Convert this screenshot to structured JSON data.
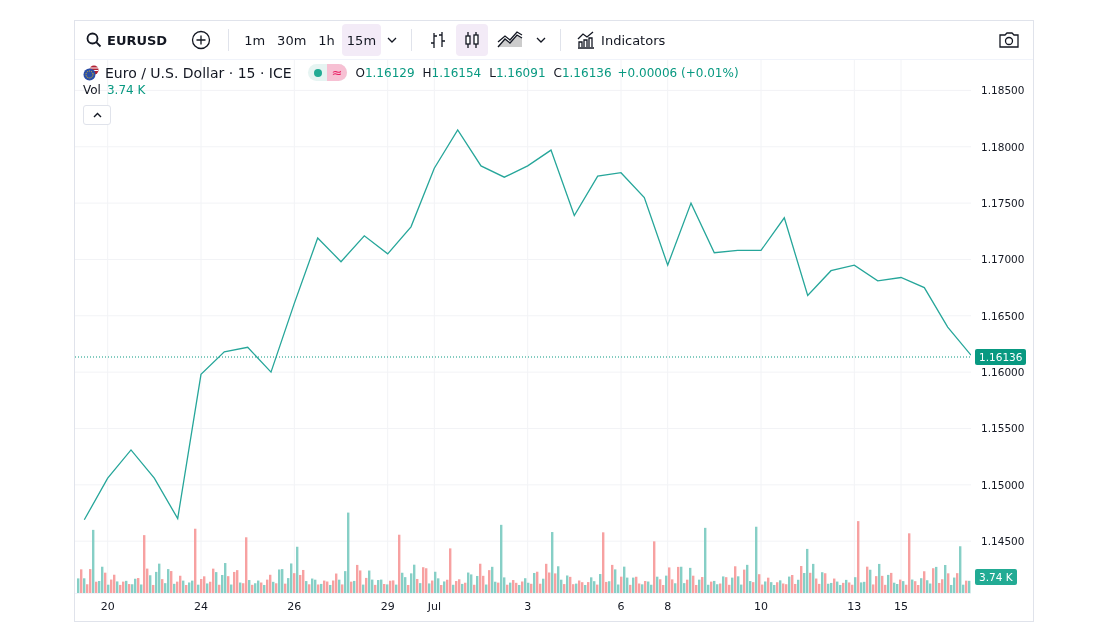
{
  "toolbar": {
    "symbol": "EURUSD",
    "intervals": [
      {
        "label": "1m",
        "selected": false
      },
      {
        "label": "30m",
        "selected": false
      },
      {
        "label": "1h",
        "selected": false
      },
      {
        "label": "15m",
        "selected": true
      }
    ],
    "chart_styles": [
      {
        "kind": "bars",
        "selected": false
      },
      {
        "kind": "candles",
        "selected": true
      },
      {
        "kind": "area",
        "selected": false
      }
    ],
    "indicators": "Indicators"
  },
  "legend": {
    "title": "Euro / U.S. Dollar · 15 · ICE",
    "status_icon": "≈",
    "ohlc": [
      {
        "label": "O",
        "value": "1.16129"
      },
      {
        "label": "H",
        "value": "1.16154"
      },
      {
        "label": "L",
        "value": "1.16091"
      },
      {
        "label": "C",
        "value": "1.16136"
      }
    ],
    "change": "+0.00006 (+0.01%)",
    "volume_label": "Vol",
    "volume_value": "3.74 K"
  },
  "chart": {
    "last_price": "1.16136",
    "last_volume": "3.74 K",
    "chart_data": {
      "type": "line",
      "categories": [
        null,
        "20",
        null,
        null,
        null,
        "24",
        null,
        null,
        null,
        "26",
        null,
        null,
        null,
        "29",
        null,
        "Jul",
        null,
        null,
        null,
        "3",
        null,
        null,
        null,
        "6",
        null,
        "8",
        null,
        null,
        null,
        "10",
        null,
        null,
        null,
        "13",
        null,
        "15",
        null,
        null,
        null
      ],
      "series": [
        {
          "color": "#26a69a",
          "values": [
            1.1469,
            1.1506,
            1.1531,
            1.1506,
            1.147,
            1.1598,
            1.1618,
            1.1622,
            1.16,
            1.1661,
            1.1719,
            1.1698,
            1.1721,
            1.1705,
            1.1729,
            1.1781,
            1.1815,
            1.1783,
            1.1773,
            1.1783,
            1.1797,
            1.1739,
            1.1774,
            1.1777,
            1.1755,
            1.1695,
            1.175,
            1.1706,
            1.1708,
            1.1708,
            1.1737,
            1.1668,
            1.169,
            1.1695,
            1.1681,
            1.1684,
            1.1675,
            1.164,
            1.1615
          ]
        }
      ],
      "ylim": [
        1.1404,
        1.1877
      ],
      "grid": true,
      "yticks": [
        {
          "value": 1.145,
          "label": "1.14500"
        },
        {
          "value": 1.15,
          "label": "1.15000"
        },
        {
          "value": 1.155,
          "label": "1.15500"
        },
        {
          "value": 1.16,
          "label": "1.16000"
        },
        {
          "value": 1.165,
          "label": "1.16500"
        },
        {
          "value": 1.17,
          "label": "1.17000"
        },
        {
          "value": 1.175,
          "label": "1.17500"
        },
        {
          "value": 1.18,
          "label": "1.18000"
        },
        {
          "value": 1.185,
          "label": "1.18500"
        }
      ]
    }
  }
}
